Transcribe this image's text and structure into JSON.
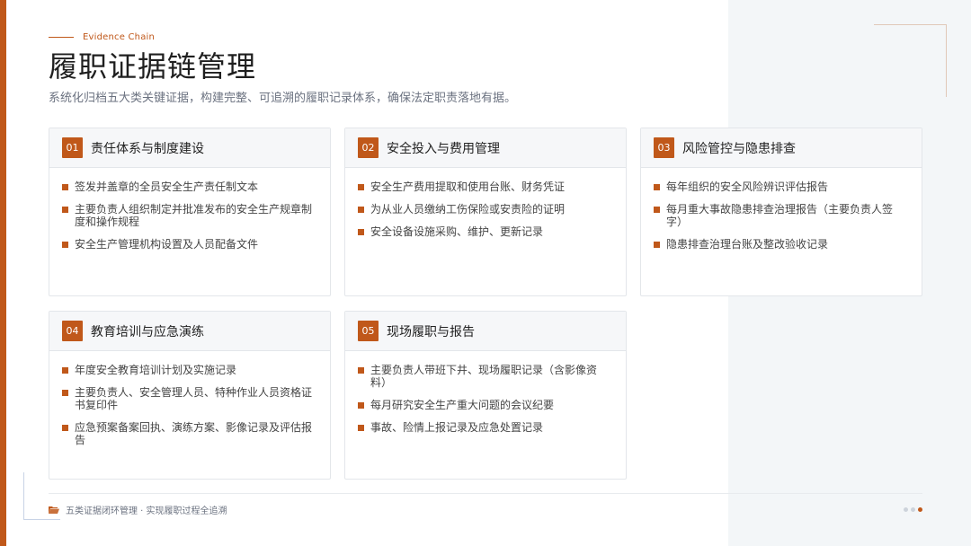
{
  "header": {
    "kicker": "Evidence Chain",
    "title": "履职证据链管理",
    "subtitle": "系统化归档五大类关键证据，构建完整、可追溯的履职记录体系，确保法定职责落地有据。"
  },
  "cards": [
    {
      "num": "01",
      "title": "责任体系与制度建设",
      "items": [
        "签发并盖章的全员安全生产责任制文本",
        "主要负责人组织制定并批准发布的安全生产规章制度和操作规程",
        "安全生产管理机构设置及人员配备文件"
      ]
    },
    {
      "num": "02",
      "title": "安全投入与费用管理",
      "items": [
        "安全生产费用提取和使用台账、财务凭证",
        "为从业人员缴纳工伤保险或安责险的证明",
        "安全设备设施采购、维护、更新记录"
      ]
    },
    {
      "num": "03",
      "title": "风险管控与隐患排查",
      "items": [
        "每年组织的安全风险辨识评估报告",
        "每月重大事故隐患排查治理报告（主要负责人签字）",
        "隐患排查治理台账及整改验收记录"
      ]
    },
    {
      "num": "04",
      "title": "教育培训与应急演练",
      "items": [
        "年度安全教育培训计划及实施记录",
        "主要负责人、安全管理人员、特种作业人员资格证书复印件",
        "应急预案备案回执、演练方案、影像记录及评估报告"
      ]
    },
    {
      "num": "05",
      "title": "现场履职与报告",
      "items": [
        "主要负责人带班下井、现场履职记录（含影像资料）",
        "每月研究安全生产重大问题的会议纪要",
        "事故、险情上报记录及应急处置记录"
      ]
    }
  ],
  "footer": {
    "icon": "folder-open-icon",
    "text": "五类证据闭环管理 · 实现履职过程全追溯"
  },
  "pagination": {
    "total": 3,
    "active": 3
  },
  "colors": {
    "accent": "#c0581a",
    "panel": "#f3f6f8"
  }
}
